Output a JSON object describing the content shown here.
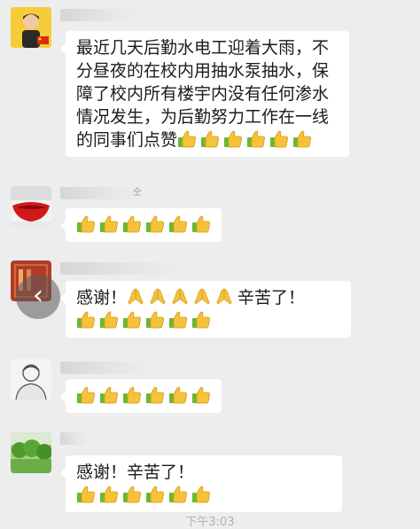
{
  "messages": [
    {
      "nickname_suffix": "",
      "text": "最近几天后勤水电工迎着大雨，不分昼夜的在校内用抽水泵抽水，保障了校内所有楼宇内没有任何渗水情况发生，为后勤努力工作在一线的同事们点赞",
      "thumbs": 6,
      "prayers": 0,
      "text_after": ""
    },
    {
      "nickname_suffix": "仝",
      "text": "",
      "thumbs": 6,
      "prayers": 0,
      "text_after": ""
    },
    {
      "nickname_suffix": "",
      "text": "感谢！",
      "prayers": 5,
      "text_after": "辛苦了！",
      "thumbs": 6
    },
    {
      "nickname_suffix": "",
      "text": "",
      "thumbs": 6,
      "prayers": 0,
      "text_after": ""
    },
    {
      "nickname_suffix": "",
      "text": "感谢！辛苦了！",
      "thumbs": 6,
      "prayers": 0,
      "text_after": ""
    }
  ],
  "timestamp": "下午3:03",
  "back_button_glyph": "‹",
  "icons": {
    "thumbs_up": "thumbs-up-icon",
    "prayer": "folded-hands-icon",
    "back": "chevron-left-icon"
  },
  "colors": {
    "chat_background": "#ededed",
    "bubble": "#ffffff",
    "thumb_yellow": "#f5c23a",
    "cuff_green": "#66bb30"
  }
}
